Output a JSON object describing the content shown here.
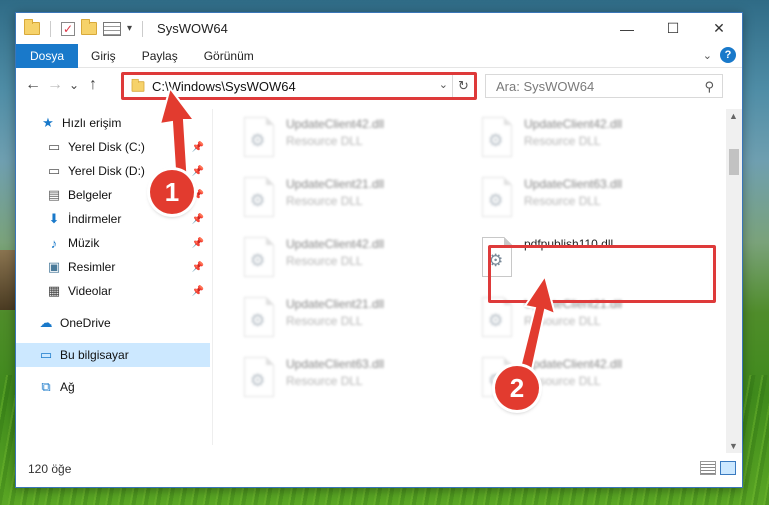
{
  "window": {
    "title": "SysWOW64",
    "controls": {
      "minimize": "—",
      "maximize": "☐",
      "close": "✕"
    }
  },
  "ribbon": {
    "tabs": [
      {
        "label": "Dosya",
        "active": true
      },
      {
        "label": "Giriş"
      },
      {
        "label": "Paylaş"
      },
      {
        "label": "Görünüm"
      }
    ],
    "expand_icon": "chevron-down-icon",
    "help_label": "?"
  },
  "navigation": {
    "back": "←",
    "forward": "→",
    "recent": "⌄",
    "up": "↑",
    "address": "C:\\Windows\\SysWOW64",
    "search_placeholder": "Ara: SysWOW64"
  },
  "sidebar": {
    "items": [
      {
        "label": "Hızlı erişim",
        "icon": "star-icon",
        "pinned": false
      },
      {
        "label": "Yerel Disk (C:)",
        "icon": "drive-icon",
        "pinned": true
      },
      {
        "label": "Yerel Disk (D:)",
        "icon": "drive-icon",
        "pinned": true
      },
      {
        "label": "Belgeler",
        "icon": "documents-icon",
        "pinned": true
      },
      {
        "label": "İndirmeler",
        "icon": "download-icon",
        "pinned": true
      },
      {
        "label": "Müzik",
        "icon": "music-icon",
        "pinned": true
      },
      {
        "label": "Resimler",
        "icon": "pictures-icon",
        "pinned": true
      },
      {
        "label": "Videolar",
        "icon": "video-icon",
        "pinned": true
      },
      {
        "label": "OneDrive",
        "icon": "cloud-icon",
        "pinned": false
      },
      {
        "label": "Bu bilgisayar",
        "icon": "computer-icon",
        "pinned": false,
        "selected": true
      },
      {
        "label": "Ağ",
        "icon": "network-icon",
        "pinned": false
      }
    ]
  },
  "files": [
    {
      "name": "UpdateClient42.dll",
      "type": "Resource DLL",
      "blurred": true
    },
    {
      "name": "UpdateClient42.dll",
      "type": "Resource DLL",
      "blurred": true
    },
    {
      "name": "UpdateClient21.dll",
      "type": "Resource DLL",
      "blurred": true
    },
    {
      "name": "UpdateClient63.dll",
      "type": "Resource DLL",
      "blurred": true
    },
    {
      "name": "UpdateClient42.dll",
      "type": "Resource DLL",
      "blurred": true
    },
    {
      "name": "pdfpublish110.dll",
      "type": "",
      "blurred": false,
      "highlighted": true
    },
    {
      "name": "UpdateClient21.dll",
      "type": "Resource DLL",
      "blurred": true
    },
    {
      "name": "UpdateClient21.dll",
      "type": "Resource DLL",
      "blurred": true
    },
    {
      "name": "UpdateClient63.dll",
      "type": "Resource DLL",
      "blurred": true
    },
    {
      "name": "UpdateClient42.dll",
      "type": "Resource DLL",
      "blurred": true
    }
  ],
  "status": {
    "count": "120 öğe"
  },
  "annotations": {
    "step1": "1",
    "step2": "2",
    "color": "#e23b2f"
  }
}
